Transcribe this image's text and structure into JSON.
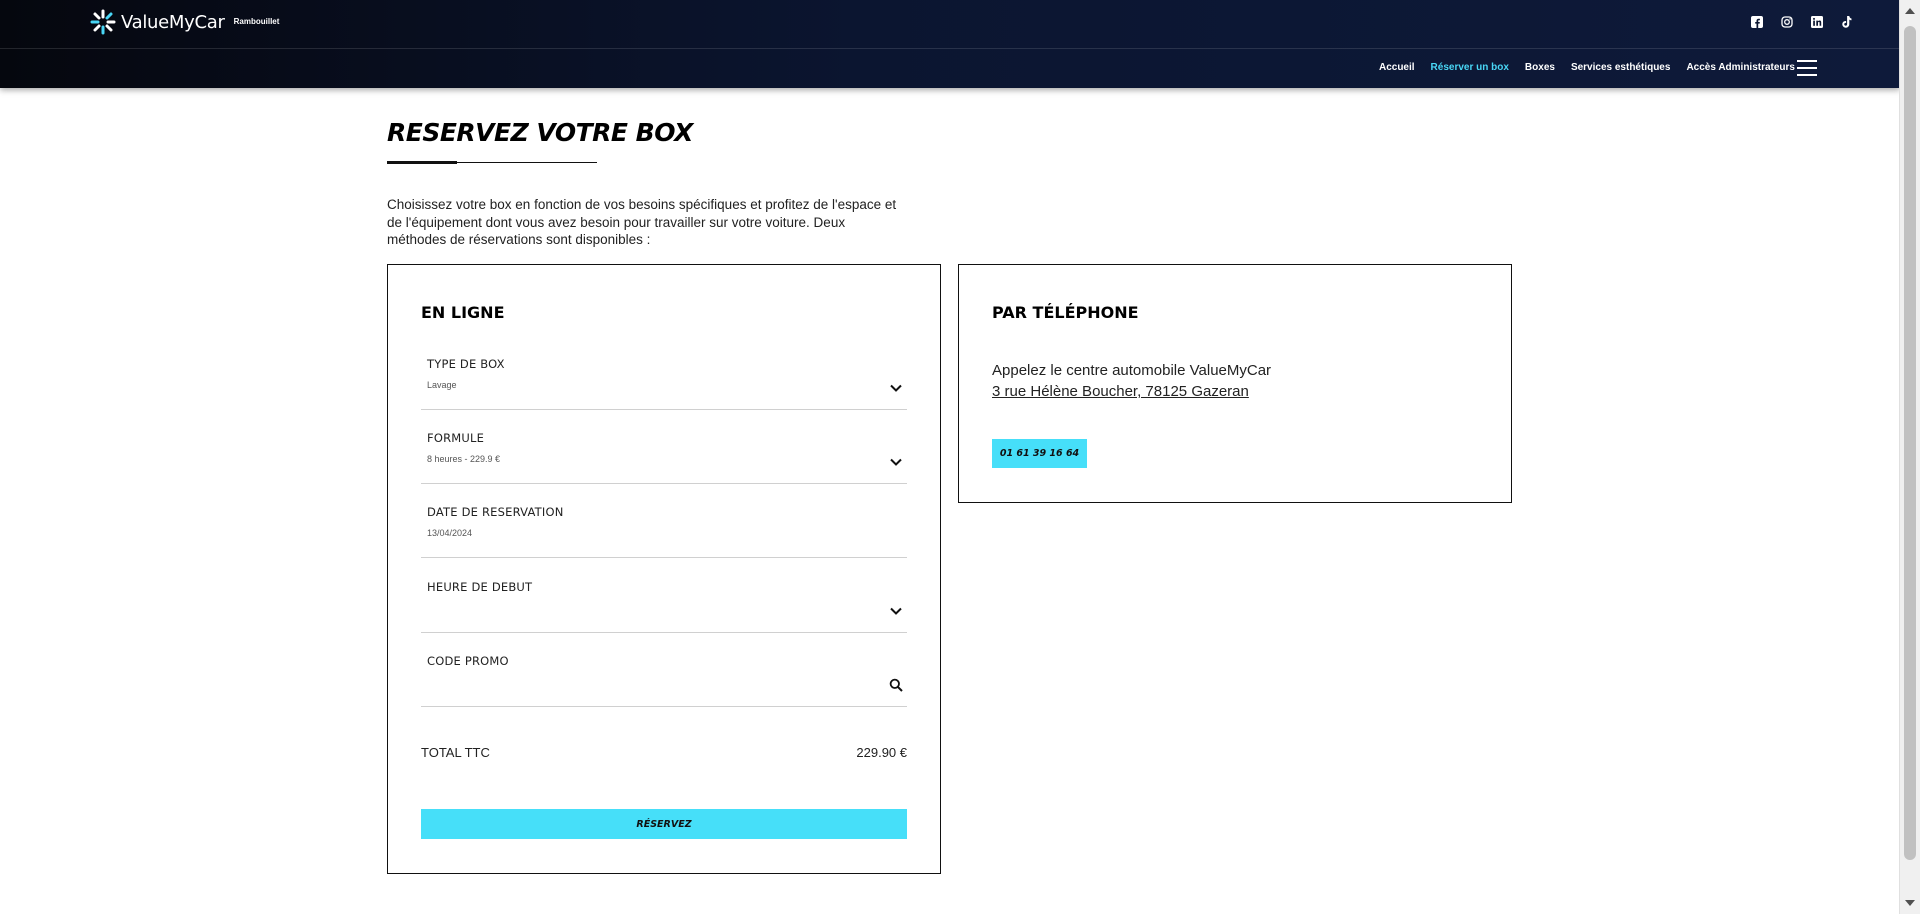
{
  "brand": {
    "name": "ValueMyCar",
    "city": "Rambouillet"
  },
  "social": [
    "facebook-icon",
    "instagram-icon",
    "linkedin-icon",
    "tiktok-icon"
  ],
  "nav": {
    "items": [
      {
        "label": "Accueil",
        "active": false
      },
      {
        "label": "Réserver un box",
        "active": true
      },
      {
        "label": "Boxes",
        "active": false
      },
      {
        "label": "Services esthétiques",
        "active": false
      },
      {
        "label": "Accès Administrateurs",
        "active": false
      }
    ],
    "accent_color": "#49d7f6"
  },
  "page": {
    "title": "RESERVEZ VOTRE BOX",
    "intro": "Choisissez votre box en fonction de vos besoins spécifiques et profitez de l'espace et de l'équipement dont vous avez besoin pour travailler sur votre voiture. Deux méthodes de réservations sont disponibles :"
  },
  "online": {
    "title": "EN LIGNE",
    "fields": [
      {
        "label": "TYPE DE BOX",
        "value": "Lavage",
        "icon": "chevron-down-icon"
      },
      {
        "label": "FORMULE",
        "value": "8 heures - 229.9 €",
        "icon": "chevron-down-icon"
      },
      {
        "label": "DATE DE RESERVATION",
        "value": "13/04/2024",
        "icon": ""
      },
      {
        "label": "HEURE DE DEBUT",
        "value": "",
        "icon": "chevron-down-icon"
      },
      {
        "label": "CODE PROMO",
        "value": "",
        "icon": "search-icon"
      }
    ],
    "total_label": "TOTAL TTC",
    "total_value": "229.90 €",
    "button_label": "RÉSERVEZ"
  },
  "phone": {
    "title": "PAR TÉLÉPHONE",
    "text": "Appelez le centre automobile ValueMyCar",
    "address": "3 rue Hélène Boucher, 78125 Gazeran",
    "number": "01 61 39 16 64"
  },
  "colors": {
    "header_bg": "#0b1530",
    "button_bg": "#46dff9",
    "text": "#111111"
  }
}
